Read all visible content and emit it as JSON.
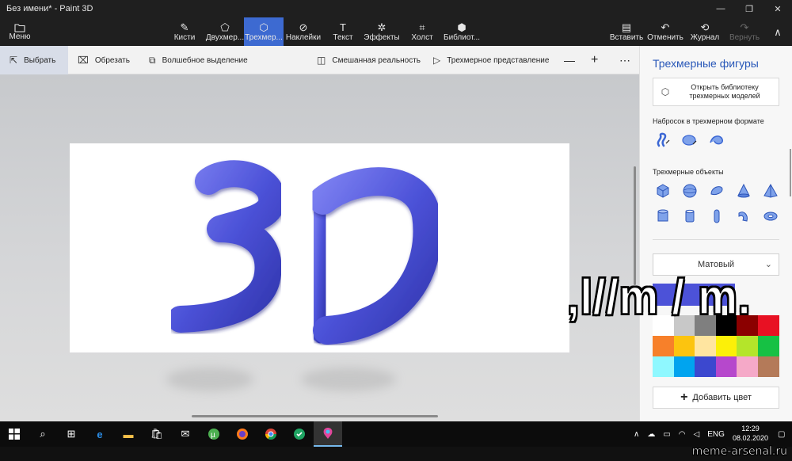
{
  "window": {
    "title": "Без имени* - Paint 3D",
    "minimize": "—",
    "maximize": "❐",
    "close": "✕"
  },
  "ribbon": {
    "menu_label": "Меню",
    "tools": [
      {
        "label": "Кисти",
        "icon": "brush-icon",
        "glyph": "🖌"
      },
      {
        "label": "Двухмер...",
        "icon": "2d-shapes-icon",
        "glyph": "⬠"
      },
      {
        "label": "Трехмер...",
        "icon": "3d-shapes-icon",
        "glyph": "⬡"
      },
      {
        "label": "Наклейки",
        "icon": "stickers-icon",
        "glyph": "⊘"
      },
      {
        "label": "Текст",
        "icon": "text-icon",
        "glyph": "T"
      },
      {
        "label": "Эффекты",
        "icon": "effects-icon",
        "glyph": "✲"
      },
      {
        "label": "Холст",
        "icon": "canvas-icon",
        "glyph": "⌗"
      },
      {
        "label": "Библиот...",
        "icon": "library-icon",
        "glyph": "⬢"
      }
    ],
    "actions": [
      {
        "label": "Вставить",
        "icon": "paste-icon",
        "glyph": "📋"
      },
      {
        "label": "Отменить",
        "icon": "undo-icon",
        "glyph": "↶"
      },
      {
        "label": "Журнал",
        "icon": "history-icon",
        "glyph": "⟲"
      },
      {
        "label": "Вернуть",
        "icon": "redo-icon",
        "glyph": "↷"
      }
    ],
    "collapse": "∧"
  },
  "subbar": {
    "select": "Выбрать",
    "crop": "Обрезать",
    "magic_select": "Волшебное выделение",
    "mixed_reality": "Смешанная реальность",
    "view_3d": "Трехмерное представление",
    "zoom_out": "—",
    "zoom_in": "+",
    "more": "⋯"
  },
  "canvas": {
    "art_text": "3D"
  },
  "overlay": {
    "meme_text": ",l//m / m."
  },
  "panel": {
    "title": "Трехмерные фигуры",
    "open_library": "Открыть библиотеку трехмерных моделей",
    "sketch_label": "Набросок в трехмерном формате",
    "objects_label": "Трехмерные объекты",
    "material": "Матовый",
    "add_color": "Добавить цвет",
    "palette": [
      "#ffffff",
      "#c8c8c8",
      "#7f7f7f",
      "#000000",
      "#8b0000",
      "#e81123",
      "#f7802a",
      "#fcc40f",
      "#ffe5a0",
      "#fcf008",
      "#b4e52a",
      "#16c144",
      "#8ff8ff",
      "#00a4ef",
      "#3c48cf",
      "#b648cc",
      "#f5a9c8",
      "#b47a59"
    ],
    "accent_color": "#4c52d8"
  },
  "taskbar": {
    "lang": "ENG",
    "time": "12:29",
    "date": "08.02.2020"
  },
  "watermark": "meme-arsenal.ru"
}
